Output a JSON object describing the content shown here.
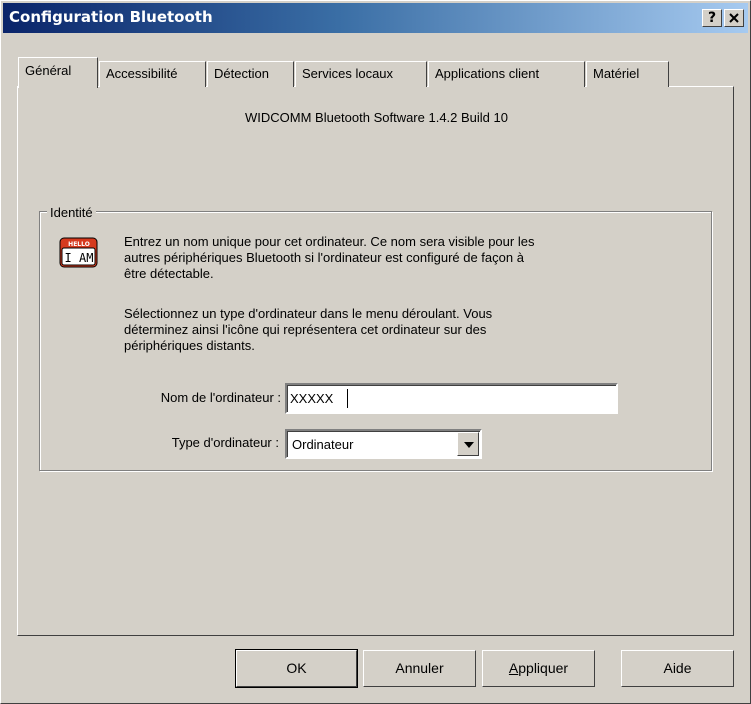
{
  "window": {
    "title": "Configuration Bluetooth",
    "help_button": "?",
    "close_button": "✕"
  },
  "tabs": [
    {
      "label": "Général",
      "active": true
    },
    {
      "label": "Accessibilité",
      "active": false
    },
    {
      "label": "Détection",
      "active": false
    },
    {
      "label": "Services locaux",
      "active": false
    },
    {
      "label": "Applications client",
      "active": false
    },
    {
      "label": "Matériel",
      "active": false
    }
  ],
  "general": {
    "version": "WIDCOMM Bluetooth Software 1.4.2 Build 10",
    "identity_group": {
      "legend": "Identité",
      "icon": "hello-i-am-badge-icon",
      "icon_text_top": "HELLO",
      "icon_text_main": "I AM",
      "paragraph1_line1": "Entrez un nom unique pour cet ordinateur. Ce nom sera visible pour les",
      "paragraph1_line2": "autres périphériques Bluetooth si l'ordinateur est configuré de façon à",
      "paragraph1_line3": "être détectable.",
      "paragraph2_line1": "Sélectionnez un type d'ordinateur dans le menu déroulant. Vous",
      "paragraph2_line2": "déterminez ainsi l'icône qui représentera cet ordinateur sur des",
      "paragraph2_line3": "périphériques distants.",
      "computer_name_label": "Nom de l'ordinateur :",
      "computer_name_value": "XXXXX",
      "computer_type_label": "Type d'ordinateur :",
      "computer_type_value": "Ordinateur"
    }
  },
  "buttons": {
    "ok": "OK",
    "cancel": "Annuler",
    "apply_prefix": "A",
    "apply_rest": "ppliquer",
    "help": "Aide"
  },
  "colors": {
    "face": "#d4d0c8",
    "titlebar_start": "#0a246a",
    "titlebar_end": "#a6caf0",
    "badge_red": "#d63a1e"
  }
}
